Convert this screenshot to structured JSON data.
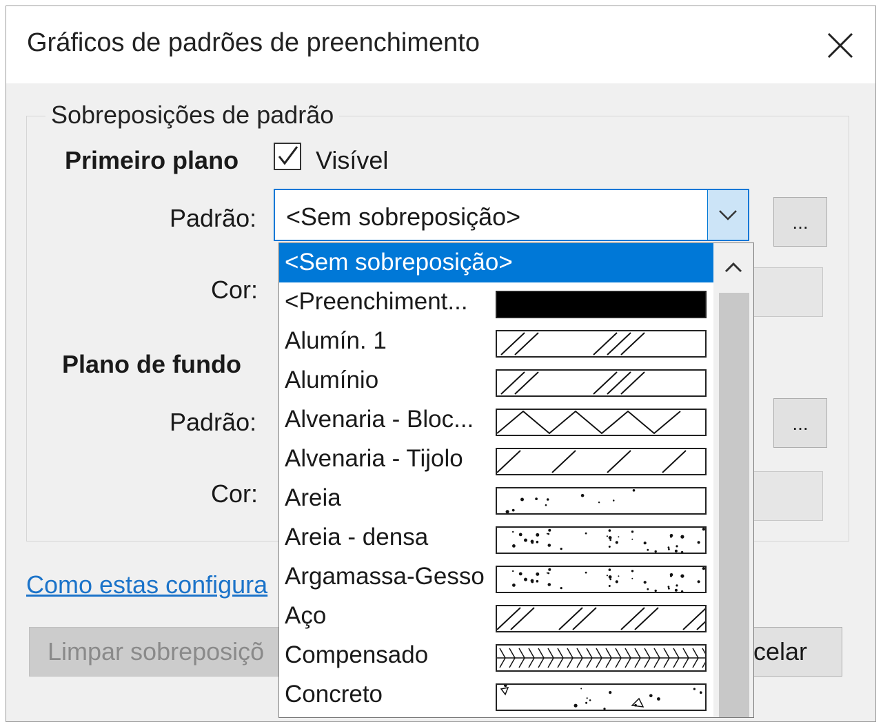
{
  "dialog": {
    "title": "Gráficos de padrões de preenchimento",
    "close_icon": "close-icon"
  },
  "group": {
    "legend": "Sobreposições de padrão"
  },
  "foreground": {
    "heading": "Primeiro plano",
    "visible_label": "Visível",
    "visible_checked": true,
    "pattern_label": "Padrão:",
    "pattern_value": "<Sem sobreposição>",
    "color_label": "Cor:",
    "browse_label": "..."
  },
  "background": {
    "heading": "Plano de fundo",
    "pattern_label": "Padrão:",
    "color_label": "Cor:",
    "browse_label": "..."
  },
  "help_link": "Como estas configura",
  "buttons": {
    "clear": "Limpar sobreposiçõ",
    "cancel": "celar"
  },
  "dropdown": {
    "selected_index": 0,
    "items": [
      {
        "label": "<Sem sobreposição>",
        "pattern": "none"
      },
      {
        "label": "<Preenchiment...",
        "pattern": "solid"
      },
      {
        "label": "Alumín. 1",
        "pattern": "aluminum"
      },
      {
        "label": "Alumínio",
        "pattern": "aluminum"
      },
      {
        "label": "Alvenaria - Bloc...",
        "pattern": "zigzag"
      },
      {
        "label": "Alvenaria - Tijolo",
        "pattern": "diagonal-sparse"
      },
      {
        "label": "Areia",
        "pattern": "sand"
      },
      {
        "label": "Areia - densa",
        "pattern": "sand-dense"
      },
      {
        "label": "Argamassa-Gesso",
        "pattern": "sand-dense"
      },
      {
        "label": "Aço",
        "pattern": "diagonal-pairs"
      },
      {
        "label": "Compensado",
        "pattern": "plywood"
      },
      {
        "label": "Concreto",
        "pattern": "concrete"
      }
    ]
  },
  "colors": {
    "accent": "#0078d7",
    "accent_light": "#cce4f7",
    "link": "#1b73c9"
  }
}
